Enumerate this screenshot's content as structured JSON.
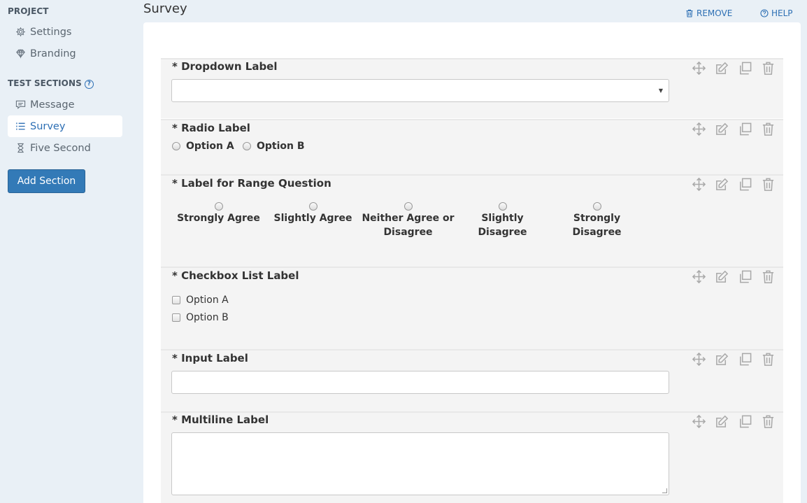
{
  "sidebar": {
    "project_heading": "PROJECT",
    "project_items": [
      {
        "label": "Settings",
        "icon": "gear-icon"
      },
      {
        "label": "Branding",
        "icon": "diamond-icon"
      }
    ],
    "test_sections_heading": "TEST SECTIONS",
    "test_items": [
      {
        "label": "Message",
        "icon": "message-icon"
      },
      {
        "label": "Survey",
        "icon": "list-icon",
        "active": true
      },
      {
        "label": "Five Second",
        "icon": "hourglass-icon"
      }
    ],
    "add_section_label": "Add Section"
  },
  "header": {
    "title": "Survey",
    "remove_label": "REMOVE",
    "help_label": "HELP"
  },
  "questions": {
    "dropdown": {
      "label": "* Dropdown Label",
      "value": ""
    },
    "radio": {
      "label": "* Radio Label",
      "options": [
        "Option A",
        "Option B"
      ]
    },
    "range": {
      "label": "* Label for Range Question",
      "options": [
        "Strongly Agree",
        "Slightly Agree",
        "Neither Agree or Disagree",
        "Slightly Disagree",
        "Strongly Disagree"
      ]
    },
    "checkbox": {
      "label": "* Checkbox List Label",
      "options": [
        "Option A",
        "Option B"
      ]
    },
    "input": {
      "label": "* Input Label",
      "value": ""
    },
    "multiline": {
      "label": "* Multiline Label",
      "value": ""
    }
  },
  "colors": {
    "accent": "#2d6fb4",
    "button": "#337ab7",
    "background": "#e9f0f6",
    "question_bg": "#f4f4f4"
  }
}
